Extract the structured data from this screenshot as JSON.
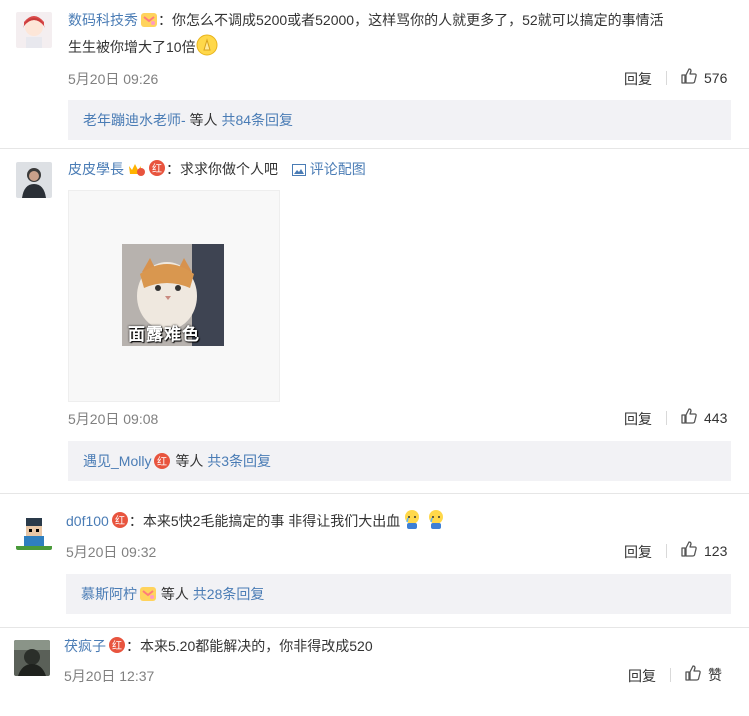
{
  "comments": [
    {
      "username": "数码科技秀",
      "text": "：你怎么不调成5200或者52000，这样骂你的人就更多了，52就可以搞定的事情活",
      "text_line2": "生生被你增大了10倍",
      "time": "5月20日 09:26",
      "reply_label": "回复",
      "like_count": "576",
      "sub": {
        "author": "老年蹦迪水老师-",
        "mid": " 等人 ",
        "count": "共84条回复"
      }
    },
    {
      "username": "皮皮學長",
      "text": "：求求你做个人吧",
      "view_image": "评论配图",
      "image_caption": "面露难色",
      "time": "5月20日 09:08",
      "reply_label": "回复",
      "like_count": "443",
      "sub": {
        "author": "遇见_Molly",
        "mid": " 等人 ",
        "count": "共3条回复"
      }
    },
    {
      "username": "d0f100",
      "text": "：本来5快2毛能搞定的事  非得让我们大出血",
      "time": "5月20日 09:32",
      "reply_label": "回复",
      "like_count": "123",
      "sub": {
        "author": "慕斯阿柠",
        "mid": " 等人 ",
        "count": "共28条回复"
      }
    },
    {
      "username": "茯疯子",
      "text": "：本来5.20都能解决的，你非得改成520",
      "time": "5月20日 12:37",
      "reply_label": "回复",
      "like_count": "赞"
    }
  ],
  "colors": {
    "link": "#4a7cb5",
    "accent": "#eb7350",
    "subbar_bg": "#f2f2f5",
    "meta": "#808080"
  },
  "icons": [
    "like-thumb-icon",
    "image-icon",
    "red-badge-icon",
    "member-badge-icon",
    "crying-emoji-icon",
    "prayer-emoji-icon"
  ]
}
